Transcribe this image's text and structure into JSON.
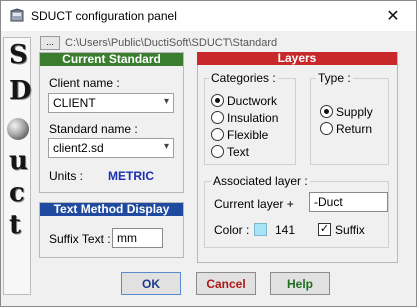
{
  "window": {
    "title": "SDUCT configuration panel",
    "close_glyph": "✕"
  },
  "side_strip": {
    "letters": [
      "S",
      "D",
      "u",
      "c",
      "t"
    ]
  },
  "path": {
    "browse_label": "...",
    "value": "C:\\Users\\Public\\DuctiSoft\\SDUCT\\Standard"
  },
  "current_standard": {
    "header": "Current Standard",
    "client_label": "Client name :",
    "client_value": "CLIENT",
    "standard_label": "Standard name :",
    "standard_value": "client2.sd",
    "units_label": "Units :",
    "units_value": "METRIC"
  },
  "text_method": {
    "header": "Text Method Display",
    "suffix_label": "Suffix Text :",
    "suffix_value": "mm"
  },
  "layers": {
    "header": "Layers",
    "categories_title": "Categories :",
    "categories": [
      {
        "label": "Ductwork",
        "selected": true
      },
      {
        "label": "Insulation",
        "selected": false
      },
      {
        "label": "Flexible",
        "selected": false
      },
      {
        "label": "Text",
        "selected": false
      }
    ],
    "type_title": "Type :",
    "types": [
      {
        "label": "Supply",
        "selected": true
      },
      {
        "label": "Return",
        "selected": false
      }
    ],
    "associated_title": "Associated layer :",
    "current_layer_label": "Current layer +",
    "current_layer_value": "-Duct",
    "color_label": "Color :",
    "color_value": "141",
    "color_hex": "#a8e4f8",
    "suffix_checkbox_label": "Suffix",
    "suffix_checked": true
  },
  "buttons": {
    "ok": "OK",
    "cancel": "Cancel",
    "help": "Help"
  },
  "colors": {
    "green_header": "#3a7d2e",
    "blue_header": "#1f4aa0",
    "red_header": "#c8282a",
    "metric_text": "#1a2fb0"
  }
}
